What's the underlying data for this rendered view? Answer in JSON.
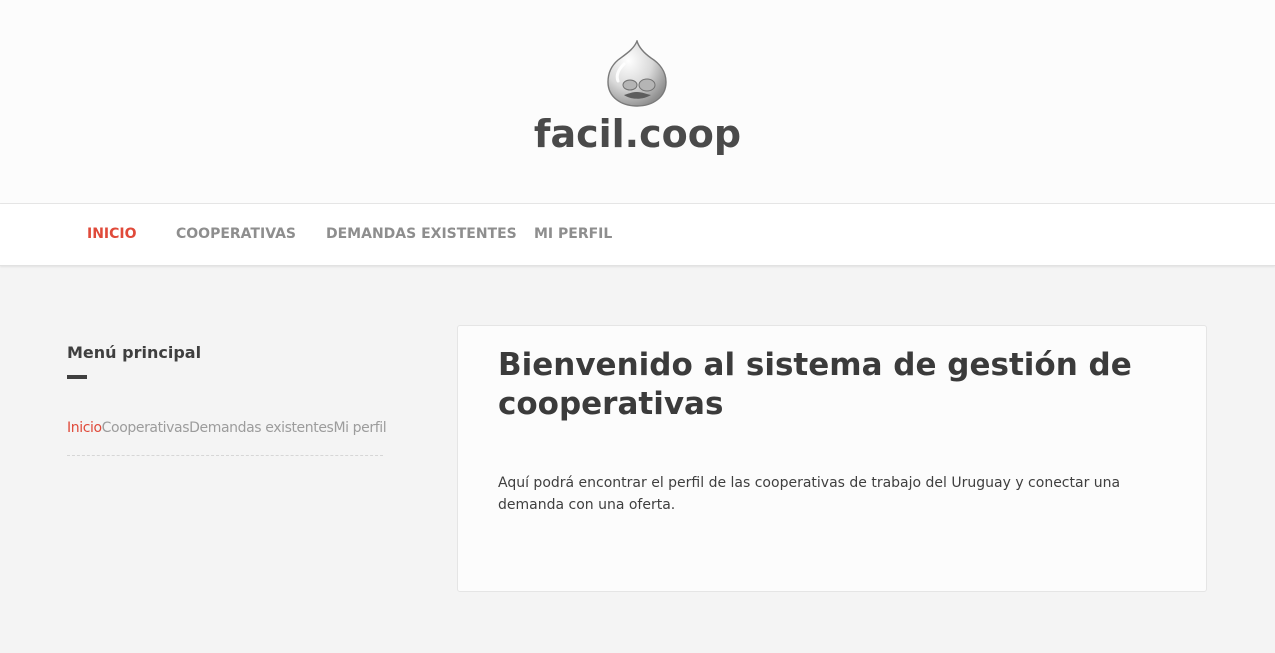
{
  "header": {
    "site_name": "facil.coop",
    "logo_icon": "drupal-drop-logo"
  },
  "nav": {
    "items": [
      {
        "label": "INICIO",
        "active": true
      },
      {
        "label": "COOPERATIVAS",
        "active": false
      },
      {
        "label": "DEMANDAS EXISTENTES",
        "active": false
      },
      {
        "label": "MI PERFIL",
        "active": false
      }
    ],
    "active_color": "#e04a3a",
    "inactive_color": "#8e8e8e"
  },
  "sidebar": {
    "title": "Menú principal",
    "items": [
      {
        "label": "Inicio",
        "active": true
      },
      {
        "label": "Cooperativas",
        "active": false
      },
      {
        "label": "Demandas existentes",
        "active": false
      },
      {
        "label": "Mi perfil",
        "active": false
      }
    ]
  },
  "main": {
    "title": "Bienvenido al sistema de gestión de cooperativas",
    "body": "Aquí podrá encontrar el perfil de las cooperativas de trabajo del Uruguay y conectar una demanda con una oferta."
  }
}
